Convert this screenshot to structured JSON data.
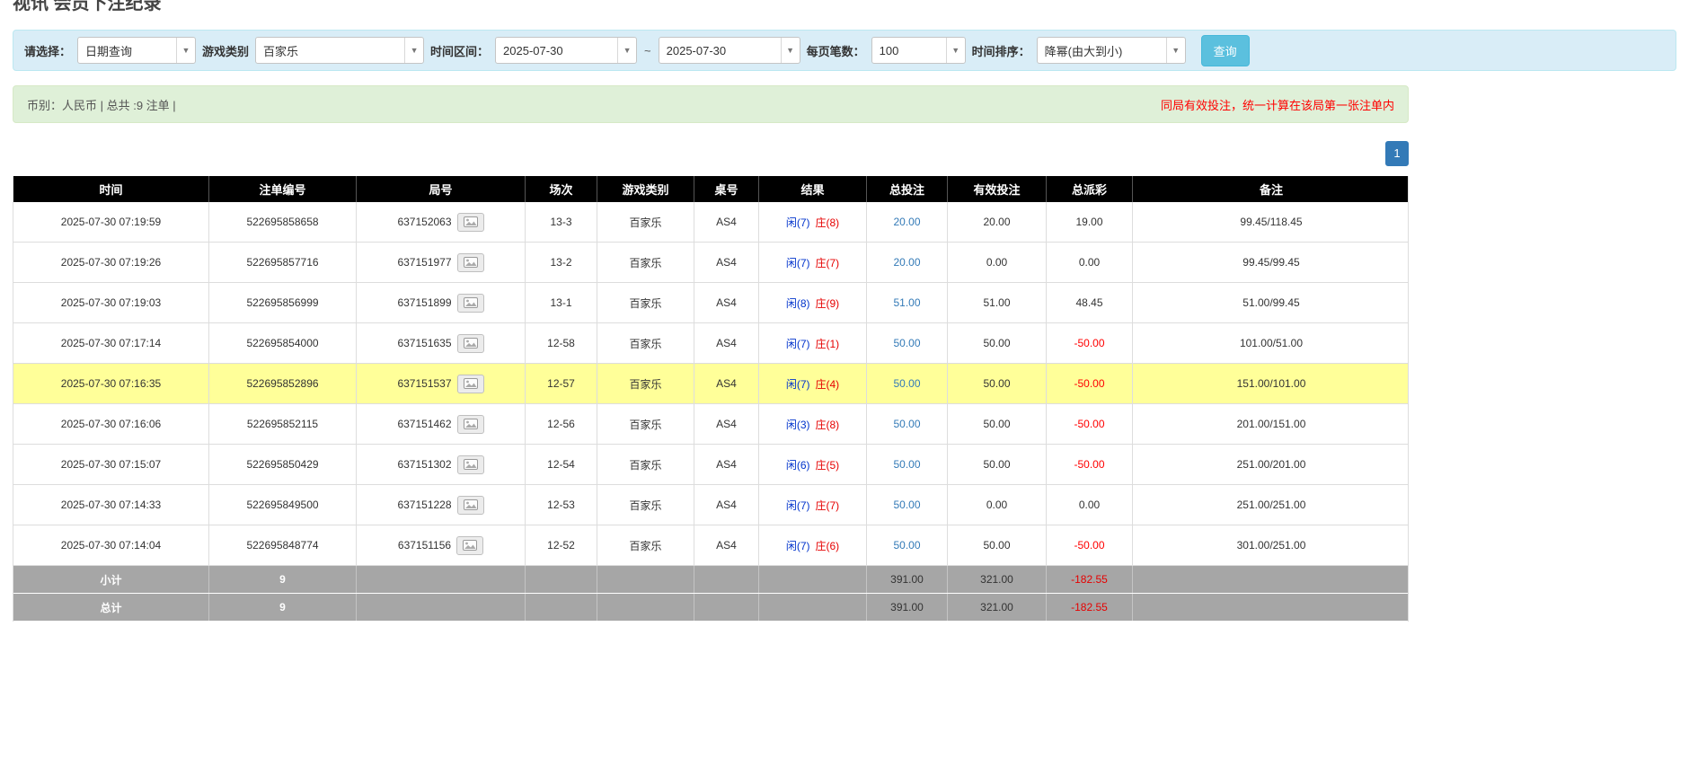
{
  "page_title": "视讯 会员下注纪录",
  "filter": {
    "select_label": "请选择：",
    "select_value": "日期查询",
    "game_type_label": "游戏类别",
    "game_type_value": "百家乐",
    "time_range_label": "时间区间：",
    "date_from": "2025-07-30",
    "tilde": "~",
    "date_to": "2025-07-30",
    "page_size_label": "每页笔数：",
    "page_size_value": "100",
    "sort_label": "时间排序：",
    "sort_value": "降幂(由大到小)",
    "search_button": "查询"
  },
  "summary": {
    "left_text": "币别：人民币 | 总共 :9 注单 |",
    "right_notice": "同局有效投注，统一计算在该局第一张注单内"
  },
  "pagination": {
    "current": "1"
  },
  "icons": {
    "round_snapshot": "image-icon",
    "select_caret": "chevron-down-icon"
  },
  "colors": {
    "query_button": "#5bc0de",
    "pagination_active": "#337ab7",
    "bet_link_blue": "#337ab7",
    "player_blue": "#0033cc",
    "banker_red": "#e60000",
    "negative_red": "#ff0000",
    "highlight_row": "#ffff99",
    "filter_bar_bg": "#d9edf7",
    "summary_bar_bg": "#dff0d8",
    "table_header_bg": "#000000",
    "footer_row_bg": "#a6a6a6"
  },
  "table": {
    "headers": [
      "时间",
      "注单编号",
      "局号",
      "场次",
      "游戏类别",
      "桌号",
      "结果",
      "总投注",
      "有效投注",
      "总派彩",
      "备注"
    ],
    "rows": [
      {
        "time": "2025-07-30 07:19:59",
        "bet_id": "522695858658",
        "round_no": "637152063",
        "session": "13-3",
        "game": "百家乐",
        "table_no": "AS4",
        "result_player": "闲(7)",
        "result_banker": "庄(8)",
        "total_bet": "20.00",
        "valid_bet": "20.00",
        "payout": "19.00",
        "note": "99.45/118.45",
        "highlight": false
      },
      {
        "time": "2025-07-30 07:19:26",
        "bet_id": "522695857716",
        "round_no": "637151977",
        "session": "13-2",
        "game": "百家乐",
        "table_no": "AS4",
        "result_player": "闲(7)",
        "result_banker": "庄(7)",
        "total_bet": "20.00",
        "valid_bet": "0.00",
        "payout": "0.00",
        "note": "99.45/99.45",
        "highlight": false
      },
      {
        "time": "2025-07-30 07:19:03",
        "bet_id": "522695856999",
        "round_no": "637151899",
        "session": "13-1",
        "game": "百家乐",
        "table_no": "AS4",
        "result_player": "闲(8)",
        "result_banker": "庄(9)",
        "total_bet": "51.00",
        "valid_bet": "51.00",
        "payout": "48.45",
        "note": "51.00/99.45",
        "highlight": false
      },
      {
        "time": "2025-07-30 07:17:14",
        "bet_id": "522695854000",
        "round_no": "637151635",
        "session": "12-58",
        "game": "百家乐",
        "table_no": "AS4",
        "result_player": "闲(7)",
        "result_banker": "庄(1)",
        "total_bet": "50.00",
        "valid_bet": "50.00",
        "payout": "-50.00",
        "note": "101.00/51.00",
        "highlight": false
      },
      {
        "time": "2025-07-30 07:16:35",
        "bet_id": "522695852896",
        "round_no": "637151537",
        "session": "12-57",
        "game": "百家乐",
        "table_no": "AS4",
        "result_player": "闲(7)",
        "result_banker": "庄(4)",
        "total_bet": "50.00",
        "valid_bet": "50.00",
        "payout": "-50.00",
        "note": "151.00/101.00",
        "highlight": true
      },
      {
        "time": "2025-07-30 07:16:06",
        "bet_id": "522695852115",
        "round_no": "637151462",
        "session": "12-56",
        "game": "百家乐",
        "table_no": "AS4",
        "result_player": "闲(3)",
        "result_banker": "庄(8)",
        "total_bet": "50.00",
        "valid_bet": "50.00",
        "payout": "-50.00",
        "note": "201.00/151.00",
        "highlight": false
      },
      {
        "time": "2025-07-30 07:15:07",
        "bet_id": "522695850429",
        "round_no": "637151302",
        "session": "12-54",
        "game": "百家乐",
        "table_no": "AS4",
        "result_player": "闲(6)",
        "result_banker": "庄(5)",
        "total_bet": "50.00",
        "valid_bet": "50.00",
        "payout": "-50.00",
        "note": "251.00/201.00",
        "highlight": false
      },
      {
        "time": "2025-07-30 07:14:33",
        "bet_id": "522695849500",
        "round_no": "637151228",
        "session": "12-53",
        "game": "百家乐",
        "table_no": "AS4",
        "result_player": "闲(7)",
        "result_banker": "庄(7)",
        "total_bet": "50.00",
        "valid_bet": "0.00",
        "payout": "0.00",
        "note": "251.00/251.00",
        "highlight": false
      },
      {
        "time": "2025-07-30 07:14:04",
        "bet_id": "522695848774",
        "round_no": "637151156",
        "session": "12-52",
        "game": "百家乐",
        "table_no": "AS4",
        "result_player": "闲(7)",
        "result_banker": "庄(6)",
        "total_bet": "50.00",
        "valid_bet": "50.00",
        "payout": "-50.00",
        "note": "301.00/251.00",
        "highlight": false
      }
    ],
    "subtotal": {
      "label": "小计",
      "count": "9",
      "total_bet": "391.00",
      "valid_bet": "321.00",
      "payout": "-182.55"
    },
    "total": {
      "label": "总计",
      "count": "9",
      "total_bet": "391.00",
      "valid_bet": "321.00",
      "payout": "-182.55"
    }
  }
}
